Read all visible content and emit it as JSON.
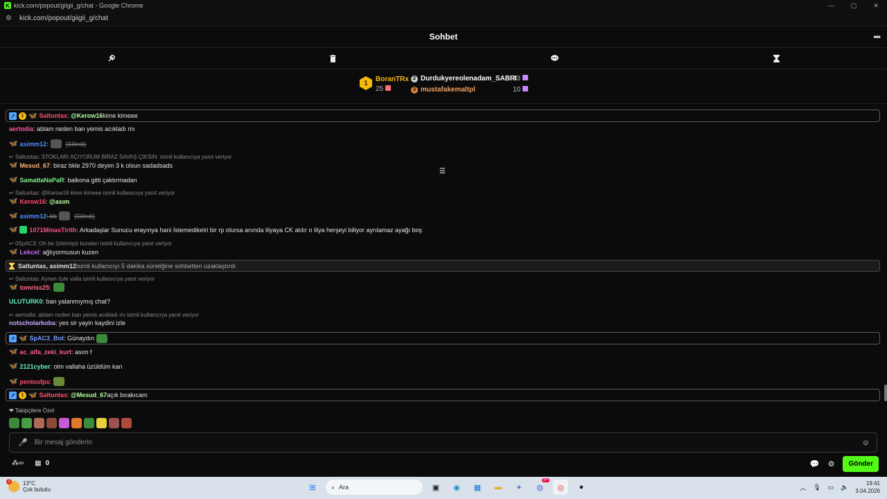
{
  "browser": {
    "window_title": "kick.com/popout/giigii_g/chat - Google Chrome",
    "url": "kick.com/popout/giigii_g/chat"
  },
  "header": {
    "title": "Sohbet",
    "more_icon": "more-dots-icon"
  },
  "mod_tools": [
    {
      "icon": "hammer-icon"
    },
    {
      "icon": "trash-icon"
    },
    {
      "icon": "chat-bubble-icon"
    },
    {
      "icon": "hourglass-icon"
    }
  ],
  "leaderboard": {
    "first": {
      "rank": "1",
      "name": "BoranTRx",
      "score": "25"
    },
    "second": {
      "rank": "2",
      "name": "Durdukyereolenadam_SABRI",
      "score": "13"
    },
    "third": {
      "rank": "3",
      "name": "mustafakemaltpl",
      "score": "10"
    }
  },
  "messages": {
    "m1": {
      "user": "Saltuntas",
      "mention": "@Kerow16",
      "text": " kime kimeee"
    },
    "m2": {
      "user": "aertodia",
      "text": ": ablam neden ban yemis acıkladı mı"
    },
    "m3": {
      "user": "asimm12",
      "deleted": "(Silindi)"
    },
    "r4": "Saltuntas: STOKLARI AÇIYORUM BİRAZ SAVAŞ ÇIKSIN. isimli kullanıcıya yanıt veriyor",
    "m4": {
      "user": "Mesud_67",
      "text": ": biraz bkle 2970 deyim 3 k olsun sadadsads"
    },
    "m5": {
      "user": "SamattaNaPaR",
      "text": ": balkona gitti çaktırmadan"
    },
    "r6": "Saltuntas: @Kerow16 kime kimeee isimli kullanıcıya yanıt veriyor",
    "m6": {
      "user": "Kerow16",
      "mention": "@asım"
    },
    "m7": {
      "user": "asimm12",
      "text": ": bb",
      "deleted": "(Silindi)"
    },
    "m8": {
      "user": "1071MinasTirith",
      "text": ": Arkadaşlar Sunucu erayınya hani İstemedikelri bir rp olursa anında lilyaya CK atılır o lilya herşeyi biliyor ayrılamaz ayağı boş"
    },
    "r9": "0SpAC3: Oh be özlemişiz buraları isimli kullanıcıya yanıt veriyor",
    "m9": {
      "user": "Lekcel",
      "text": ": ağlıyormusun kuzen"
    },
    "sys": {
      "users": "Saltuntas, asimm12",
      "text": " isimli kullanıcıyı 5 dakika süreliğine sohbetten uzaklaştırdı"
    },
    "r10": "Saltuntas: Aynen öyle valla isimli kullanıcıya yanıt veriyor",
    "m10": {
      "user": "tomriss25"
    },
    "m11": {
      "user": "ULUTURK0",
      "text": ": ban yalanmıymış chat?"
    },
    "r12": "aertodia: ablam neden ban yemis acıkladı mı isimli kullanıcıya yanıt veriyor",
    "m12": {
      "user": "notscholarkoba",
      "text": ": yes sir yayin kaydini izle"
    },
    "m13": {
      "user": "SpAC3_Bot",
      "text": ": Günaydın"
    },
    "m14": {
      "user": "ac_alfa_zeki_kurt",
      "text": ": asım f"
    },
    "m15": {
      "user": "2121cyber",
      "text": ": olm vallaha üzüldüm kan"
    },
    "m16": {
      "user": "pentosfps"
    },
    "m17": {
      "user": "Saltuntas",
      "mention": "@Mesud_67",
      "text": " açık bırakıcam"
    }
  },
  "composer": {
    "followers_only": "Takipçilere Özel",
    "placeholder": "Bir mesaj gönderin",
    "count": "0",
    "send_label": "Gönder"
  },
  "taskbar": {
    "temperature": "13°C",
    "weather": "Çok bulutlu",
    "weather_badge": "1",
    "search_label": "Ara",
    "time": "19:41",
    "date": "3.04.2026",
    "discord_badge": "9+"
  },
  "colors": {
    "brand": "#53fc18",
    "gold": "#f5b90f"
  }
}
